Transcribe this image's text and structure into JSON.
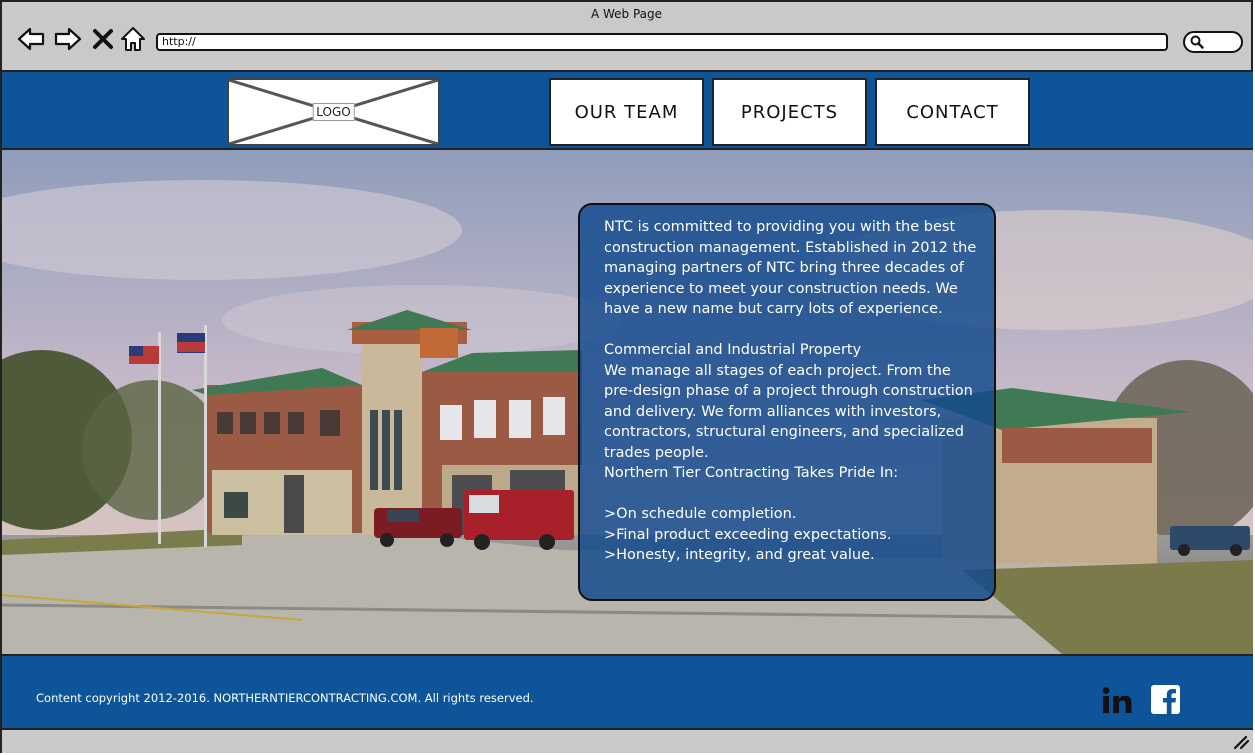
{
  "browser": {
    "title": "A Web Page",
    "url": "http://"
  },
  "header": {
    "logo_label": "LOGO",
    "nav": [
      {
        "label": "OUR TEAM"
      },
      {
        "label": "PROJECTS"
      },
      {
        "label": "CONTACT"
      }
    ]
  },
  "info": {
    "intro": "NTC is committed to providing you with the best construction management. Established in 2012 the managing partners of NTC bring three decades of experience to meet your construction needs.  We have a new name but carry lots of experience.",
    "section_title": "Commercial and Industrial Property",
    "section_body": "We manage all stages of each project. From the pre-design phase of a project through construction and delivery. We form alliances with investors, contractors, structural engineers, and specialized trades people.",
    "pride_heading": "Northern Tier Contracting Takes Pride In:",
    "points": [
      ">On schedule completion.",
      ">Final product exceeding expectations.",
      ">Honesty, integrity, and great value."
    ]
  },
  "footer": {
    "copyright": "Content copyright 2012-2016. NORTHERNTIERCONTRACTING.COM. All rights reserved.",
    "social_icons": [
      "linkedin-icon",
      "facebook-icon"
    ]
  },
  "colors": {
    "brand_blue": "#0d5598",
    "chrome_gray": "#c9c9c9"
  }
}
